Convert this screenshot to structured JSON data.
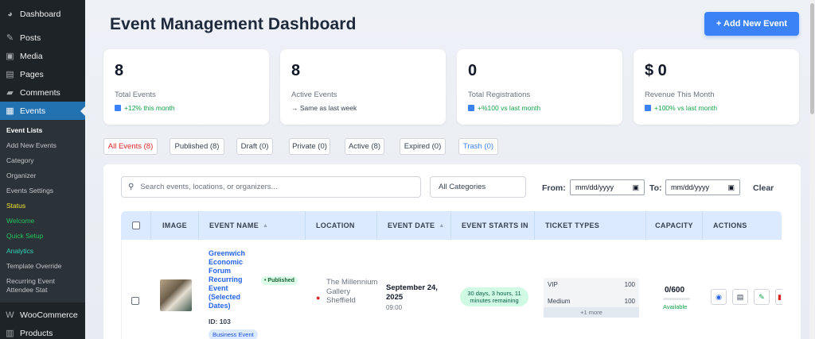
{
  "sidebar": {
    "top": [
      {
        "label": "Dashboard",
        "icon": "dashboard-icon",
        "glyph": "◕"
      },
      {
        "label": "Posts",
        "icon": "pin-icon",
        "glyph": "✎"
      },
      {
        "label": "Media",
        "icon": "media-icon",
        "glyph": "▣"
      },
      {
        "label": "Pages",
        "icon": "pages-icon",
        "glyph": "▤"
      },
      {
        "label": "Comments",
        "icon": "comments-icon",
        "glyph": "▰"
      },
      {
        "label": "Events",
        "icon": "calendar-icon",
        "glyph": "▦"
      }
    ],
    "sub": [
      "Event Lists",
      "Add New Events",
      "Category",
      "Organizer",
      "Events Settings",
      "Status",
      "Welcome",
      "Quick Setup",
      "Analytics",
      "Template Override",
      "Recurring Event Attendee Stat"
    ],
    "bottom": [
      {
        "label": "WooCommerce",
        "icon": "woocommerce-icon",
        "glyph": "W"
      },
      {
        "label": "Products",
        "icon": "products-icon",
        "glyph": "▥"
      }
    ]
  },
  "header": {
    "title": "Event Management Dashboard",
    "add_button": "+ Add New Event"
  },
  "stats": [
    {
      "value": "8",
      "label": "Total Events",
      "change": "+12% this month"
    },
    {
      "value": "8",
      "label": "Active Events",
      "change": "→ Same as last week"
    },
    {
      "value": "0",
      "label": "Total Registrations",
      "change": "+%100 vs last month"
    },
    {
      "value": "$ 0",
      "label": "Revenue This Month",
      "change": "+100% vs last month"
    }
  ],
  "filters": [
    "All Events (8)",
    "Published (8)",
    "Draft (0)",
    "Private (0)",
    "Active (8)",
    "Expired (0)",
    "Trash (0)"
  ],
  "toolbar": {
    "search_placeholder": "Search events, locations, or organizers...",
    "category": "All Categories",
    "from_label": "From:",
    "to_label": "To:",
    "date_placeholder": "mm/dd/yyyy",
    "clear": "Clear"
  },
  "table": {
    "headers": [
      "IMAGE",
      "EVENT NAME",
      "LOCATION",
      "EVENT DATE",
      "EVENT STARTS IN",
      "TICKET TYPES",
      "CAPACITY",
      "ACTIONS"
    ],
    "row": {
      "name": "Greenwich Economic Forum Recurring Event (Selected Dates)",
      "status": "• Published",
      "id": "ID: 103",
      "category": "Business Event",
      "location": "The Millennium Gallery Sheffield",
      "date": "September 24, 2025",
      "time": "09:00",
      "starts_in": "30 days, 3 hours, 11 minutes remaining",
      "tickets": [
        {
          "name": "VIP",
          "qty": "100"
        },
        {
          "name": "Medium",
          "qty": "100"
        }
      ],
      "more": "+1 more",
      "capacity": "0/600",
      "capacity_fraction": 0,
      "availability": "Available"
    }
  }
}
